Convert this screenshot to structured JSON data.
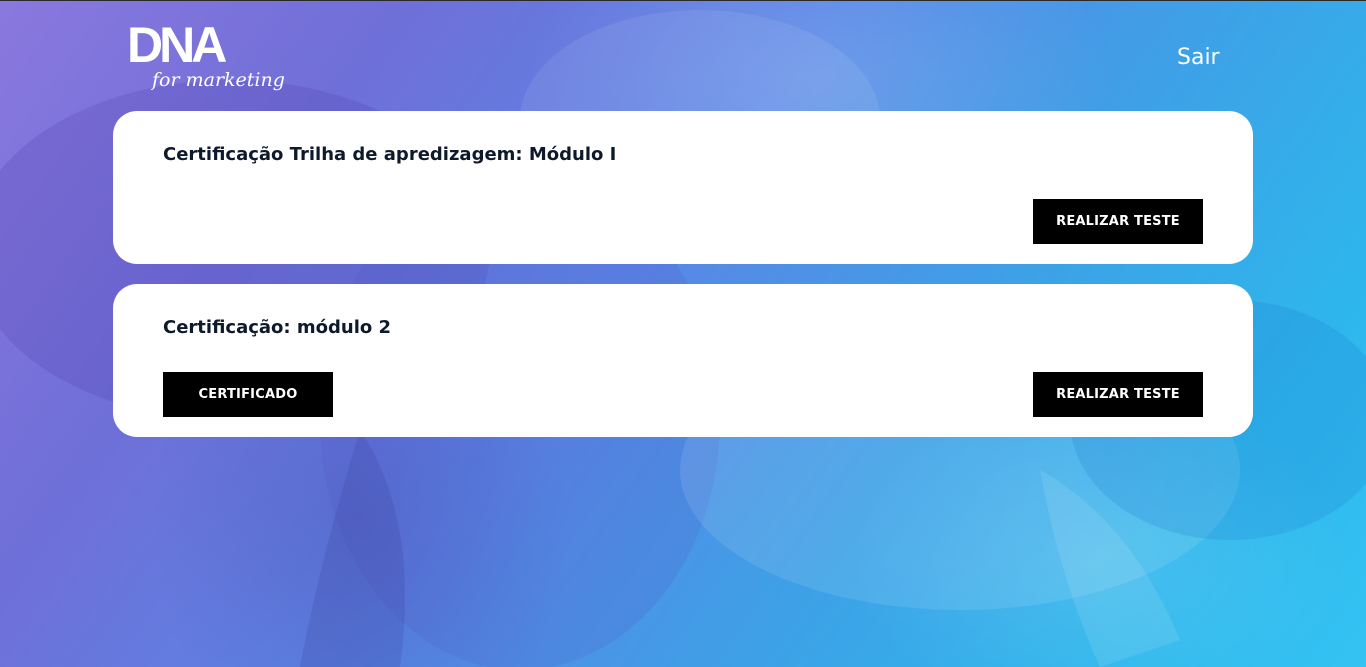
{
  "header": {
    "logo_primary": "DNA",
    "logo_secondary": "for marketing",
    "logout_label": "Sair"
  },
  "cards": [
    {
      "title": "Certificação Trilha de apredizagem: Módulo I",
      "test_button_label": "REALIZAR TESTE"
    },
    {
      "title": "Certificação: módulo 2",
      "certificate_button_label": "CERTIFICADO",
      "test_button_label": "REALIZAR TESTE"
    }
  ],
  "colors": {
    "card_background": "#ffffff",
    "button_background": "#000000",
    "button_text": "#ffffff",
    "title_text": "#0e1a2b",
    "background_gradient_start": "#8a78de",
    "background_gradient_end": "#34c3f3"
  }
}
